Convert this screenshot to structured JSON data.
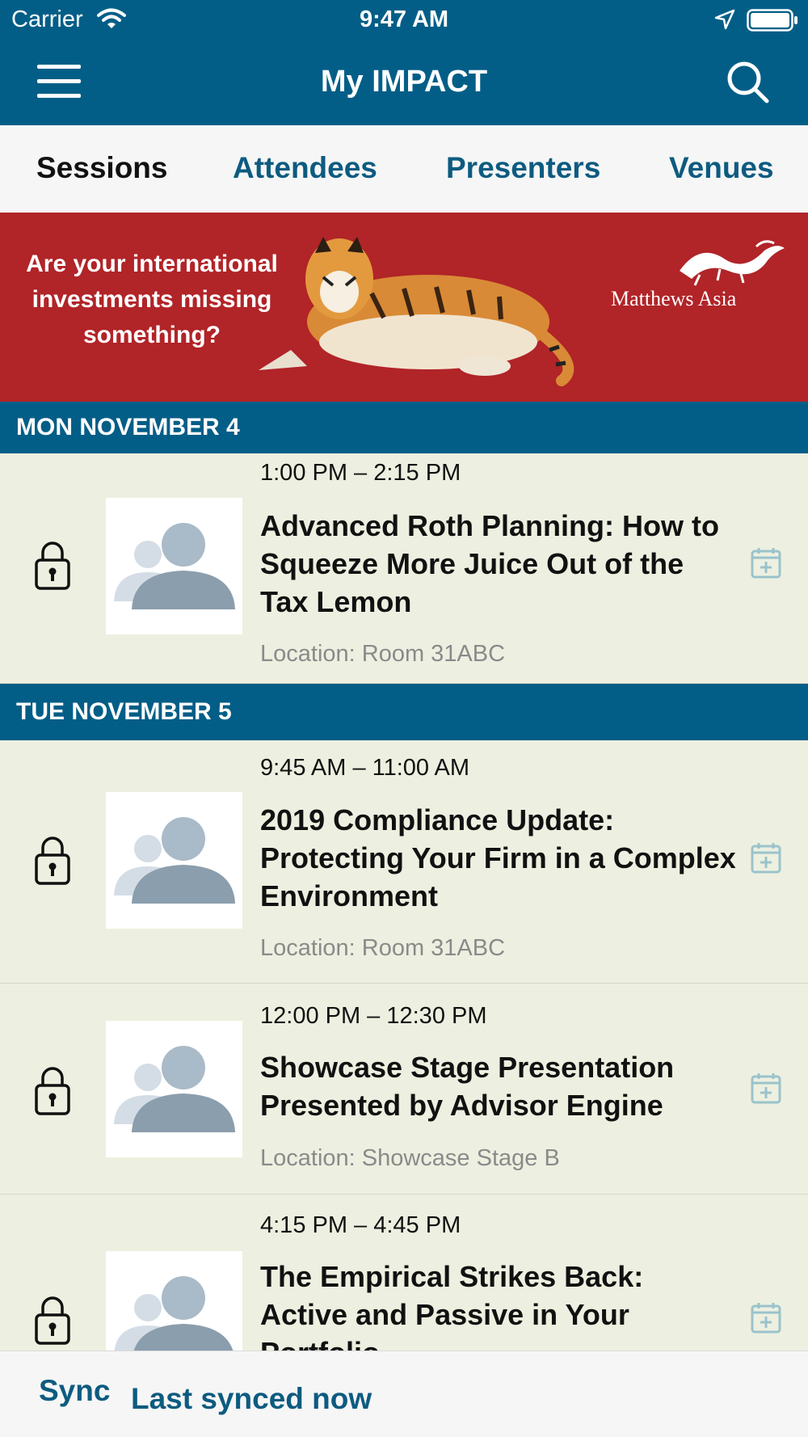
{
  "status_bar": {
    "carrier": "Carrier",
    "time": "9:47 AM"
  },
  "navbar": {
    "title": "My IMPACT",
    "menu_icon": "hamburger-icon",
    "search_icon": "search-icon"
  },
  "tabs": [
    {
      "label": "Sessions",
      "active": true
    },
    {
      "label": "Attendees",
      "active": false
    },
    {
      "label": "Presenters",
      "active": false
    },
    {
      "label": "Venues",
      "active": false
    }
  ],
  "banner": {
    "headline": "Are your international investments missing something?",
    "brand": "Matthews Asia",
    "background_color": "#b12428"
  },
  "days": [
    {
      "label": "MON NOVEMBER 4"
    },
    {
      "label": "TUE NOVEMBER 5"
    }
  ],
  "sessions": [
    {
      "time": "1:00 PM – 2:15 PM",
      "title": "Advanced Roth Planning: How to Squeeze More Juice Out of the Tax Lemon",
      "location": "Location: Room 31ABC"
    },
    {
      "time": "9:45 AM – 11:00 AM",
      "title": "2019 Compliance Update: Protecting Your Firm in a Complex Environment",
      "location": "Location: Room 31ABC"
    },
    {
      "time": "12:00 PM – 12:30 PM",
      "title": "Showcase Stage Presentation Presented by Advisor Engine",
      "location": "Location: Showcase Stage B"
    },
    {
      "time": "4:15 PM – 4:45 PM",
      "title": "The Empirical Strikes Back: Active and Passive in Your Portfolio",
      "location": ""
    }
  ],
  "footer": {
    "sync_label": "Sync",
    "status": "Last synced now"
  },
  "colors": {
    "brand_blue": "#025e87",
    "link_blue": "#0d5b80",
    "row_bg": "#edf0e0",
    "calendar_icon": "#9ac3cc"
  }
}
